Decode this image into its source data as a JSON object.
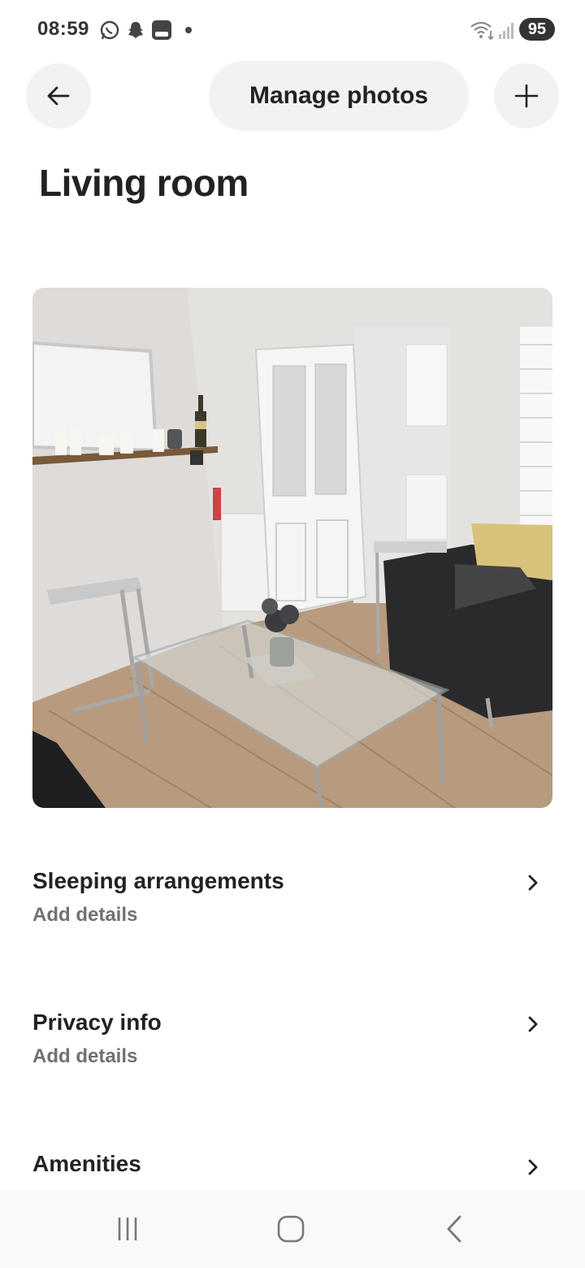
{
  "status_bar": {
    "time": "08:59",
    "battery": "95",
    "icons": [
      "whatsapp-icon",
      "snapchat-icon",
      "app-icon",
      "wifi-icon",
      "signal-icon"
    ]
  },
  "header": {
    "back_icon": "arrow-left-icon",
    "manage_label": "Manage photos",
    "add_icon": "plus-icon"
  },
  "page": {
    "title": "Living room"
  },
  "photo": {
    "description_icon": "room-photo"
  },
  "rows": [
    {
      "title": "Sleeping arrangements",
      "subtitle": "Add details"
    },
    {
      "title": "Privacy info",
      "subtitle": "Add details"
    },
    {
      "title": "Amenities"
    }
  ],
  "navbar": {
    "icons": [
      "recents-icon",
      "home-icon",
      "back-icon"
    ]
  },
  "colors": {
    "text": "#222222",
    "muted": "#717171",
    "button_bg": "#f2f2f2"
  }
}
